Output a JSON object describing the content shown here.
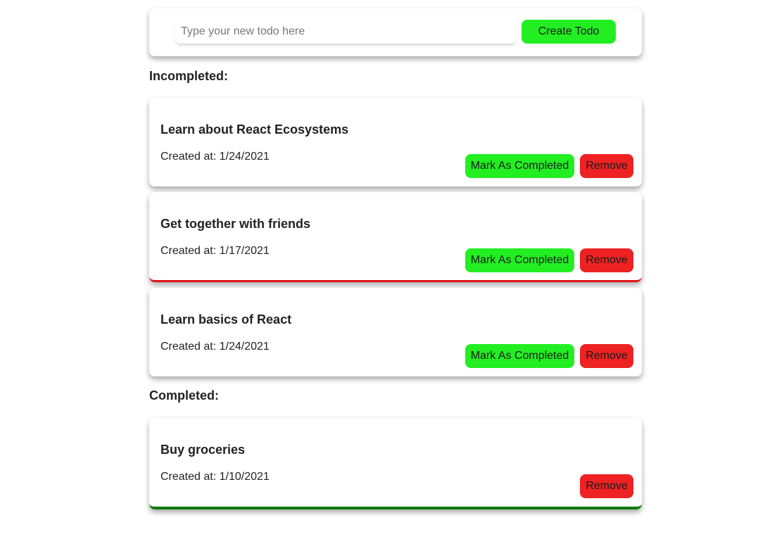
{
  "new_todo": {
    "placeholder": "Type your new todo here",
    "value": "",
    "create_label": "Create Todo"
  },
  "sections": {
    "incompleted_heading": "Incompleted:",
    "completed_heading": "Completed:"
  },
  "todos": {
    "incomplete": [
      {
        "title": "Learn about React Ecosystems",
        "created": "Created at: 1/24/2021",
        "complete_label": "Mark As Completed",
        "remove_label": "Remove"
      },
      {
        "title": "Get together with friends",
        "created": "Created at: 1/17/2021",
        "complete_label": "Mark As Completed",
        "remove_label": "Remove"
      },
      {
        "title": "Learn basics of React",
        "created": "Created at: 1/24/2021",
        "complete_label": "Mark As Completed",
        "remove_label": "Remove"
      }
    ],
    "complete": [
      {
        "title": "Buy groceries",
        "created": "Created at: 1/10/2021",
        "remove_label": "Remove"
      }
    ]
  },
  "colors": {
    "primary_button": "#22ee22",
    "remove_button": "#ee2222",
    "overdue_border": "#e01515",
    "completed_border": "#0d7a0d"
  }
}
